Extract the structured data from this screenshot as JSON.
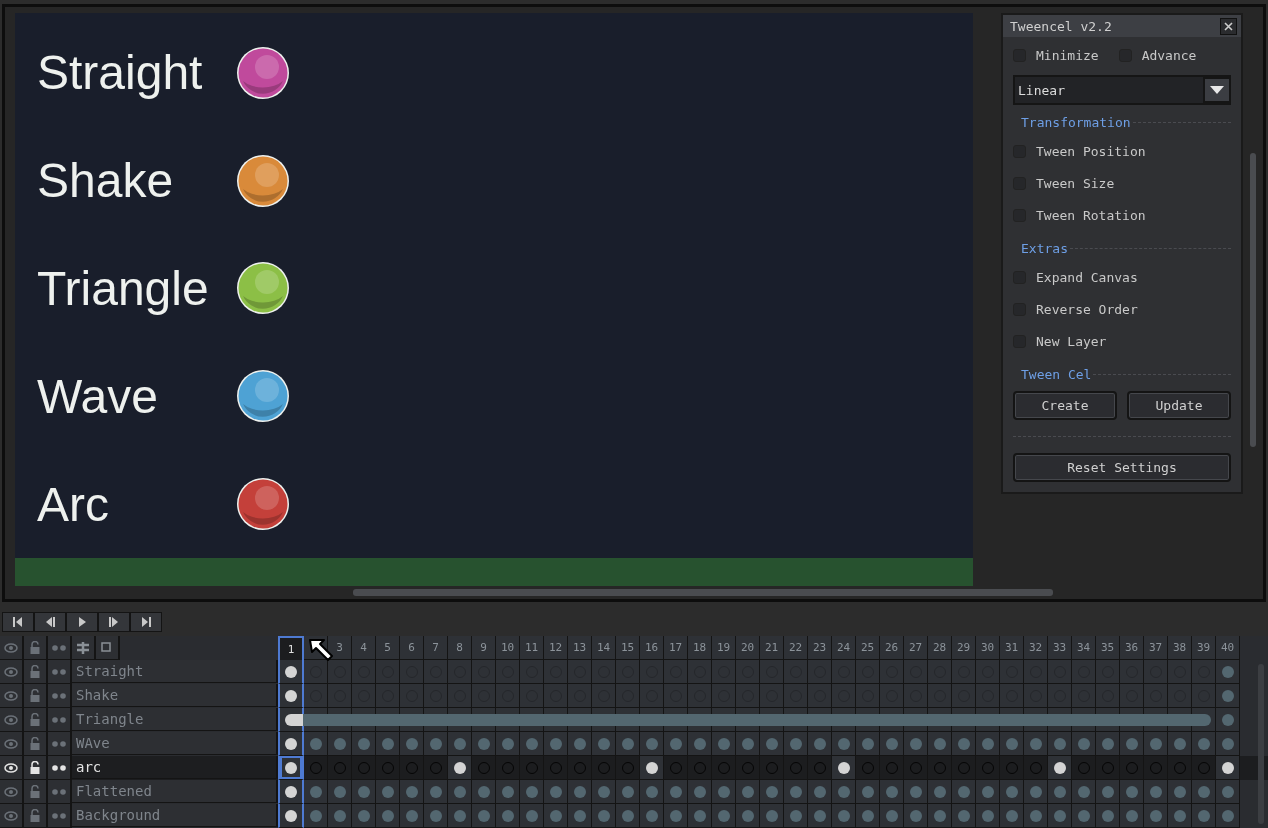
{
  "canvas": {
    "items": [
      {
        "label": "Straight",
        "color": "#c04a9c"
      },
      {
        "label": "Shake",
        "color": "#d98a3a"
      },
      {
        "label": "Triangle",
        "color": "#8cbf46"
      },
      {
        "label": "Wave",
        "color": "#4ea2d4"
      },
      {
        "label": "Arc",
        "color": "#c4403a"
      }
    ]
  },
  "dialog": {
    "title": "Tweencel v2.2",
    "top_options": [
      {
        "label": "Minimize",
        "checked": false
      },
      {
        "label": "Advance",
        "checked": false
      }
    ],
    "easing": {
      "value": "Linear"
    },
    "sections": [
      {
        "heading": "Transformation",
        "options": [
          {
            "label": "Tween Position",
            "checked": false
          },
          {
            "label": "Tween Size",
            "checked": false
          },
          {
            "label": "Tween Rotation",
            "checked": false
          }
        ]
      },
      {
        "heading": "Extras",
        "options": [
          {
            "label": "Expand Canvas",
            "checked": false
          },
          {
            "label": "Reverse Order",
            "checked": false
          },
          {
            "label": "New Layer",
            "checked": false
          }
        ]
      },
      {
        "heading": "Tween Cel",
        "buttons": [
          "Create",
          "Update"
        ]
      }
    ],
    "reset_button": "Reset Settings"
  },
  "timeline": {
    "frames": [
      {
        "label": "1",
        "selected": true
      },
      {
        "selected": false
      },
      {
        "label": "3",
        "selected": false
      },
      {
        "label": "4",
        "selected": false
      },
      {
        "label": "5",
        "selected": false
      },
      {
        "label": "6",
        "selected": false
      },
      {
        "label": "7",
        "selected": false
      },
      {
        "label": "8",
        "selected": false
      },
      {
        "label": "9",
        "selected": false
      },
      {
        "label": "10",
        "selected": false
      },
      {
        "label": "11",
        "selected": false
      },
      {
        "label": "12",
        "selected": false
      },
      {
        "label": "13",
        "selected": false
      },
      {
        "label": "14",
        "selected": false
      },
      {
        "label": "15",
        "selected": false
      },
      {
        "label": "16",
        "selected": false
      },
      {
        "label": "17",
        "selected": false
      },
      {
        "label": "18",
        "selected": false
      },
      {
        "label": "19",
        "selected": false
      },
      {
        "label": "20",
        "selected": false
      },
      {
        "label": "21",
        "selected": false
      },
      {
        "label": "22",
        "selected": false
      },
      {
        "label": "23",
        "selected": false
      },
      {
        "label": "24",
        "selected": false
      },
      {
        "label": "25",
        "selected": false
      },
      {
        "label": "26",
        "selected": false
      },
      {
        "label": "27",
        "selected": false
      },
      {
        "label": "28",
        "selected": false
      },
      {
        "label": "29",
        "selected": false
      },
      {
        "label": "30",
        "selected": false
      },
      {
        "label": "31",
        "selected": false
      },
      {
        "label": "32",
        "selected": false
      },
      {
        "label": "33",
        "selected": false
      },
      {
        "label": "34",
        "selected": false
      },
      {
        "label": "35",
        "selected": false
      },
      {
        "label": "36",
        "selected": false
      },
      {
        "label": "37",
        "selected": false
      },
      {
        "label": "38",
        "selected": false
      },
      {
        "label": "39",
        "selected": false
      },
      {
        "label": "40",
        "selected": false
      }
    ],
    "layers": [
      {
        "name": "Straight",
        "selected": false,
        "cels": [
          {
            "kind": "key"
          },
          {
            "kind": "empty"
          },
          {
            "kind": "empty"
          },
          {
            "kind": "empty"
          },
          {
            "kind": "empty"
          },
          {
            "kind": "empty"
          },
          {
            "kind": "empty"
          },
          {
            "kind": "empty"
          },
          {
            "kind": "empty"
          },
          {
            "kind": "empty"
          },
          {
            "kind": "empty"
          },
          {
            "kind": "empty"
          },
          {
            "kind": "empty"
          },
          {
            "kind": "empty"
          },
          {
            "kind": "empty"
          },
          {
            "kind": "empty"
          },
          {
            "kind": "empty"
          },
          {
            "kind": "empty"
          },
          {
            "kind": "empty"
          },
          {
            "kind": "empty"
          },
          {
            "kind": "empty"
          },
          {
            "kind": "empty"
          },
          {
            "kind": "empty"
          },
          {
            "kind": "empty"
          },
          {
            "kind": "empty"
          },
          {
            "kind": "empty"
          },
          {
            "kind": "empty"
          },
          {
            "kind": "empty"
          },
          {
            "kind": "empty"
          },
          {
            "kind": "empty"
          },
          {
            "kind": "empty"
          },
          {
            "kind": "empty"
          },
          {
            "kind": "empty"
          },
          {
            "kind": "empty"
          },
          {
            "kind": "empty"
          },
          {
            "kind": "empty"
          },
          {
            "kind": "empty"
          },
          {
            "kind": "empty"
          },
          {
            "kind": "empty"
          },
          {
            "kind": "linked"
          }
        ]
      },
      {
        "name": "Shake",
        "selected": false,
        "cels": [
          {
            "kind": "key"
          },
          {
            "kind": "empty"
          },
          {
            "kind": "empty"
          },
          {
            "kind": "empty"
          },
          {
            "kind": "empty"
          },
          {
            "kind": "empty"
          },
          {
            "kind": "empty"
          },
          {
            "kind": "empty"
          },
          {
            "kind": "empty"
          },
          {
            "kind": "empty"
          },
          {
            "kind": "empty"
          },
          {
            "kind": "empty"
          },
          {
            "kind": "empty"
          },
          {
            "kind": "empty"
          },
          {
            "kind": "empty"
          },
          {
            "kind": "empty"
          },
          {
            "kind": "empty"
          },
          {
            "kind": "empty"
          },
          {
            "kind": "empty"
          },
          {
            "kind": "empty"
          },
          {
            "kind": "empty"
          },
          {
            "kind": "empty"
          },
          {
            "kind": "empty"
          },
          {
            "kind": "empty"
          },
          {
            "kind": "empty"
          },
          {
            "kind": "empty"
          },
          {
            "kind": "empty"
          },
          {
            "kind": "empty"
          },
          {
            "kind": "empty"
          },
          {
            "kind": "empty"
          },
          {
            "kind": "empty"
          },
          {
            "kind": "empty"
          },
          {
            "kind": "empty"
          },
          {
            "kind": "empty"
          },
          {
            "kind": "empty"
          },
          {
            "kind": "empty"
          },
          {
            "kind": "empty"
          },
          {
            "kind": "empty"
          },
          {
            "kind": "empty"
          },
          {
            "kind": "linked"
          }
        ]
      },
      {
        "name": "Triangle",
        "selected": false,
        "cels": [
          {
            "kind": "spanstart"
          },
          {
            "kind": "span"
          },
          {
            "kind": "span"
          },
          {
            "kind": "span"
          },
          {
            "kind": "span"
          },
          {
            "kind": "span"
          },
          {
            "kind": "span"
          },
          {
            "kind": "span"
          },
          {
            "kind": "span"
          },
          {
            "kind": "span"
          },
          {
            "kind": "span"
          },
          {
            "kind": "span"
          },
          {
            "kind": "span"
          },
          {
            "kind": "span"
          },
          {
            "kind": "span"
          },
          {
            "kind": "span"
          },
          {
            "kind": "span"
          },
          {
            "kind": "span"
          },
          {
            "kind": "span"
          },
          {
            "kind": "span"
          },
          {
            "kind": "span"
          },
          {
            "kind": "span"
          },
          {
            "kind": "span"
          },
          {
            "kind": "span"
          },
          {
            "kind": "span"
          },
          {
            "kind": "span"
          },
          {
            "kind": "span"
          },
          {
            "kind": "span"
          },
          {
            "kind": "span"
          },
          {
            "kind": "span"
          },
          {
            "kind": "span"
          },
          {
            "kind": "span"
          },
          {
            "kind": "span"
          },
          {
            "kind": "span"
          },
          {
            "kind": "span"
          },
          {
            "kind": "span"
          },
          {
            "kind": "span"
          },
          {
            "kind": "span"
          },
          {
            "kind": "spanend"
          },
          {
            "kind": "linked"
          }
        ]
      },
      {
        "name": "WAve",
        "selected": false,
        "cels": [
          {
            "kind": "key"
          },
          {
            "kind": "linked"
          },
          {
            "kind": "linked"
          },
          {
            "kind": "linked"
          },
          {
            "kind": "linked"
          },
          {
            "kind": "linked"
          },
          {
            "kind": "linked"
          },
          {
            "kind": "linked"
          },
          {
            "kind": "linked"
          },
          {
            "kind": "linked"
          },
          {
            "kind": "linked"
          },
          {
            "kind": "linked"
          },
          {
            "kind": "linked"
          },
          {
            "kind": "linked"
          },
          {
            "kind": "linked"
          },
          {
            "kind": "linked"
          },
          {
            "kind": "linked"
          },
          {
            "kind": "linked"
          },
          {
            "kind": "linked"
          },
          {
            "kind": "linked"
          },
          {
            "kind": "linked"
          },
          {
            "kind": "linked"
          },
          {
            "kind": "linked"
          },
          {
            "kind": "linked"
          },
          {
            "kind": "linked"
          },
          {
            "kind": "linked"
          },
          {
            "kind": "linked"
          },
          {
            "kind": "linked"
          },
          {
            "kind": "linked"
          },
          {
            "kind": "linked"
          },
          {
            "kind": "linked"
          },
          {
            "kind": "linked"
          },
          {
            "kind": "linked"
          },
          {
            "kind": "linked"
          },
          {
            "kind": "linked"
          },
          {
            "kind": "linked"
          },
          {
            "kind": "linked"
          },
          {
            "kind": "linked"
          },
          {
            "kind": "linked"
          },
          {
            "kind": "linked"
          }
        ]
      },
      {
        "name": "arc",
        "selected": true,
        "cels": [
          {
            "kind": "key"
          },
          {
            "kind": "empty"
          },
          {
            "kind": "empty"
          },
          {
            "kind": "empty"
          },
          {
            "kind": "empty"
          },
          {
            "kind": "empty"
          },
          {
            "kind": "empty"
          },
          {
            "kind": "key"
          },
          {
            "kind": "empty"
          },
          {
            "kind": "empty"
          },
          {
            "kind": "empty"
          },
          {
            "kind": "empty"
          },
          {
            "kind": "empty"
          },
          {
            "kind": "empty"
          },
          {
            "kind": "empty"
          },
          {
            "kind": "key"
          },
          {
            "kind": "empty"
          },
          {
            "kind": "empty"
          },
          {
            "kind": "empty"
          },
          {
            "kind": "empty"
          },
          {
            "kind": "empty"
          },
          {
            "kind": "empty"
          },
          {
            "kind": "empty"
          },
          {
            "kind": "key"
          },
          {
            "kind": "empty"
          },
          {
            "kind": "empty"
          },
          {
            "kind": "empty"
          },
          {
            "kind": "empty"
          },
          {
            "kind": "empty"
          },
          {
            "kind": "empty"
          },
          {
            "kind": "empty"
          },
          {
            "kind": "empty"
          },
          {
            "kind": "key"
          },
          {
            "kind": "empty"
          },
          {
            "kind": "empty"
          },
          {
            "kind": "empty"
          },
          {
            "kind": "empty"
          },
          {
            "kind": "empty"
          },
          {
            "kind": "empty"
          },
          {
            "kind": "key"
          }
        ]
      },
      {
        "name": "Flattened",
        "selected": false,
        "cels": [
          {
            "kind": "key"
          },
          {
            "kind": "linked"
          },
          {
            "kind": "linked"
          },
          {
            "kind": "linked"
          },
          {
            "kind": "linked"
          },
          {
            "kind": "linked"
          },
          {
            "kind": "linked"
          },
          {
            "kind": "linked"
          },
          {
            "kind": "linked"
          },
          {
            "kind": "linked"
          },
          {
            "kind": "linked"
          },
          {
            "kind": "linked"
          },
          {
            "kind": "linked"
          },
          {
            "kind": "linked"
          },
          {
            "kind": "linked"
          },
          {
            "kind": "linked"
          },
          {
            "kind": "linked"
          },
          {
            "kind": "linked"
          },
          {
            "kind": "linked"
          },
          {
            "kind": "linked"
          },
          {
            "kind": "linked"
          },
          {
            "kind": "linked"
          },
          {
            "kind": "linked"
          },
          {
            "kind": "linked"
          },
          {
            "kind": "linked"
          },
          {
            "kind": "linked"
          },
          {
            "kind": "linked"
          },
          {
            "kind": "linked"
          },
          {
            "kind": "linked"
          },
          {
            "kind": "linked"
          },
          {
            "kind": "linked"
          },
          {
            "kind": "linked"
          },
          {
            "kind": "linked"
          },
          {
            "kind": "linked"
          },
          {
            "kind": "linked"
          },
          {
            "kind": "linked"
          },
          {
            "kind": "linked"
          },
          {
            "kind": "linked"
          },
          {
            "kind": "linked"
          },
          {
            "kind": "linked"
          }
        ]
      },
      {
        "name": "Background",
        "selected": false,
        "cels": [
          {
            "kind": "key"
          },
          {
            "kind": "linked"
          },
          {
            "kind": "linked"
          },
          {
            "kind": "linked"
          },
          {
            "kind": "linked"
          },
          {
            "kind": "linked"
          },
          {
            "kind": "linked"
          },
          {
            "kind": "linked"
          },
          {
            "kind": "linked"
          },
          {
            "kind": "linked"
          },
          {
            "kind": "linked"
          },
          {
            "kind": "linked"
          },
          {
            "kind": "linked"
          },
          {
            "kind": "linked"
          },
          {
            "kind": "linked"
          },
          {
            "kind": "linked"
          },
          {
            "kind": "linked"
          },
          {
            "kind": "linked"
          },
          {
            "kind": "linked"
          },
          {
            "kind": "linked"
          },
          {
            "kind": "linked"
          },
          {
            "kind": "linked"
          },
          {
            "kind": "linked"
          },
          {
            "kind": "linked"
          },
          {
            "kind": "linked"
          },
          {
            "kind": "linked"
          },
          {
            "kind": "linked"
          },
          {
            "kind": "linked"
          },
          {
            "kind": "linked"
          },
          {
            "kind": "linked"
          },
          {
            "kind": "linked"
          },
          {
            "kind": "linked"
          },
          {
            "kind": "linked"
          },
          {
            "kind": "linked"
          },
          {
            "kind": "linked"
          },
          {
            "kind": "linked"
          },
          {
            "kind": "linked"
          },
          {
            "kind": "linked"
          },
          {
            "kind": "linked"
          },
          {
            "kind": "linked"
          }
        ]
      }
    ]
  }
}
